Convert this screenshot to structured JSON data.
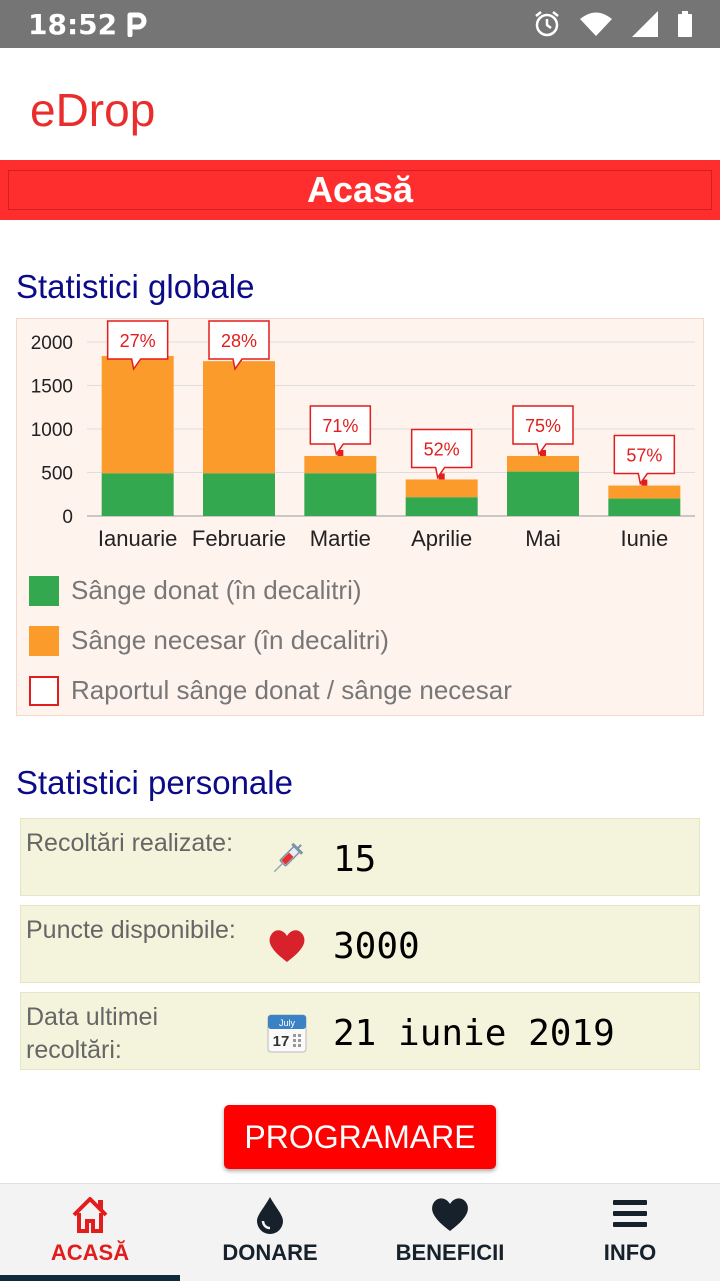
{
  "statusbar": {
    "time": "18:52"
  },
  "app": {
    "logo_text": "eDrop"
  },
  "page": {
    "title": "Acasă"
  },
  "global_stats": {
    "title": "Statistici globale",
    "legend": [
      {
        "label": "Sânge donat (în decalitri)",
        "color": "#33a84f"
      },
      {
        "label": "Sânge necesar (în decalitri)",
        "color": "#fb9b2c"
      },
      {
        "label": "Raportul sânge donat / sânge necesar",
        "color": "#e21d1d"
      }
    ]
  },
  "chart_data": {
    "type": "bar",
    "stacked": true,
    "categories": [
      "Ianuarie",
      "Februarie",
      "Martie",
      "Aprilie",
      "Mai",
      "Iunie"
    ],
    "series": [
      {
        "name": "Sânge donat (în decalitri)",
        "values": [
          490,
          490,
          490,
          215,
          510,
          200
        ],
        "color": "#33a84f"
      },
      {
        "name": "Sânge necesar (în decalitri)",
        "values": [
          1840,
          1780,
          690,
          420,
          690,
          350
        ],
        "color": "#fb9b2c"
      }
    ],
    "ratio_labels": [
      "27%",
      "28%",
      "71%",
      "52%",
      "75%",
      "57%"
    ],
    "ylim": [
      0,
      2000
    ],
    "yticks": [
      0,
      500,
      1000,
      1500,
      2000
    ],
    "grid": true,
    "legend_position": "bottom"
  },
  "personal_stats": {
    "title": "Statistici personale",
    "rows": [
      {
        "label": "Recoltări realizate:",
        "value": "15",
        "icon": "syringe-icon"
      },
      {
        "label": "Puncte disponibile:",
        "value": "3000",
        "icon": "heart-icon"
      },
      {
        "label": "Data ultimei recoltări:",
        "value": "21 iunie 2019",
        "icon": "calendar-icon"
      }
    ],
    "calendar_icon": {
      "month": "July",
      "day": "17"
    }
  },
  "cta": {
    "label": "PROGRAMARE"
  },
  "nav": [
    {
      "label": "ACASĂ",
      "icon": "home-icon",
      "active": true
    },
    {
      "label": "DONARE",
      "icon": "drop-icon",
      "active": false
    },
    {
      "label": "BENEFICII",
      "icon": "heart-icon",
      "active": false
    },
    {
      "label": "INFO",
      "icon": "menu-icon",
      "active": false
    }
  ]
}
